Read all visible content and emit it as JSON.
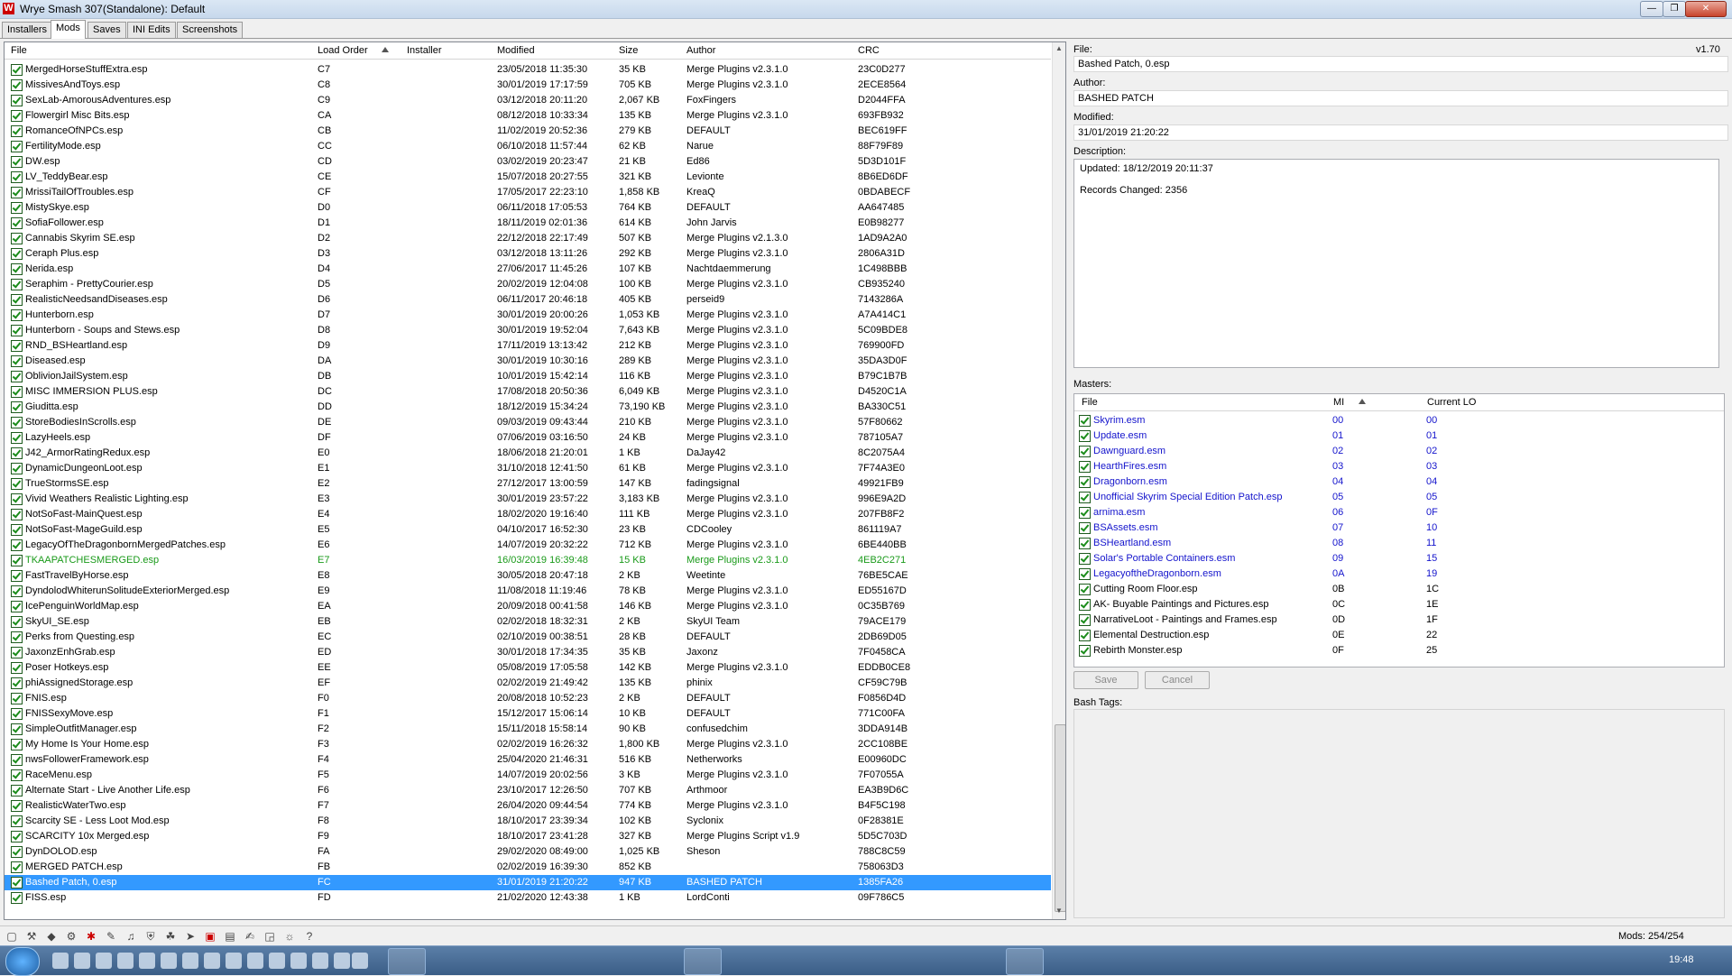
{
  "window": {
    "title": "Wrye Smash 307(Standalone): Default",
    "app_icon": "W"
  },
  "tabs": [
    "Installers",
    "Mods",
    "Saves",
    "INI Edits",
    "Screenshots"
  ],
  "mods_list": {
    "columns": {
      "file": "File",
      "load_order": "Load Order",
      "installer": "Installer",
      "modified": "Modified",
      "size": "Size",
      "author": "Author",
      "crc": "CRC"
    },
    "rows": [
      [
        "MergedHorseStuffExtra.esp",
        "C7",
        "23/05/2018 11:35:30",
        "35 KB",
        "Merge Plugins v2.3.1.0",
        "23C0D277"
      ],
      [
        "MissivesAndToys.esp",
        "C8",
        "30/01/2019 17:17:59",
        "705 KB",
        "Merge Plugins v2.3.1.0",
        "2ECE8564"
      ],
      [
        "SexLab-AmorousAdventures.esp",
        "C9",
        "03/12/2018 20:11:20",
        "2,067 KB",
        "FoxFingers",
        "D2044FFA"
      ],
      [
        "Flowergirl Misc Bits.esp",
        "CA",
        "08/12/2018 10:33:34",
        "135 KB",
        "Merge Plugins v2.3.1.0",
        "693FB932"
      ],
      [
        "RomanceOfNPCs.esp",
        "CB",
        "11/02/2019 20:52:36",
        "279 KB",
        "DEFAULT",
        "BEC619FF"
      ],
      [
        "FertilityMode.esp",
        "CC",
        "06/10/2018 11:57:44",
        "62 KB",
        "Narue",
        "88F79F89"
      ],
      [
        "DW.esp",
        "CD",
        "03/02/2019 20:23:47",
        "21 KB",
        "Ed86",
        "5D3D101F"
      ],
      [
        "LV_TeddyBear.esp",
        "CE",
        "15/07/2018 20:27:55",
        "321 KB",
        "Levionte",
        "8B6ED6DF"
      ],
      [
        "MrissiTailOfTroubles.esp",
        "CF",
        "17/05/2017 22:23:10",
        "1,858 KB",
        "KreaQ",
        "0BDABECF"
      ],
      [
        "MistySkye.esp",
        "D0",
        "06/11/2018 17:05:53",
        "764 KB",
        "DEFAULT",
        "AA647485"
      ],
      [
        "SofiaFollower.esp",
        "D1",
        "18/11/2019 02:01:36",
        "614 KB",
        "John Jarvis",
        "E0B98277"
      ],
      [
        "Cannabis Skyrim SE.esp",
        "D2",
        "22/12/2018 22:17:49",
        "507 KB",
        "Merge Plugins v2.1.3.0",
        "1AD9A2A0"
      ],
      [
        "Ceraph Plus.esp",
        "D3",
        "03/12/2018 13:11:26",
        "292 KB",
        "Merge Plugins v2.3.1.0",
        "2806A31D"
      ],
      [
        "Nerida.esp",
        "D4",
        "27/06/2017 11:45:26",
        "107 KB",
        "Nachtdaemmerung",
        "1C498BBB"
      ],
      [
        "Seraphim - PrettyCourier.esp",
        "D5",
        "20/02/2019 12:04:08",
        "100 KB",
        "Merge Plugins v2.3.1.0",
        "CB935240"
      ],
      [
        "RealisticNeedsandDiseases.esp",
        "D6",
        "06/11/2017 20:46:18",
        "405 KB",
        "perseid9",
        "7143286A"
      ],
      [
        "Hunterborn.esp",
        "D7",
        "30/01/2019 20:00:26",
        "1,053 KB",
        "Merge Plugins v2.3.1.0",
        "A7A414C1"
      ],
      [
        "Hunterborn - Soups and Stews.esp",
        "D8",
        "30/01/2019 19:52:04",
        "7,643 KB",
        "Merge Plugins v2.3.1.0",
        "5C09BDE8"
      ],
      [
        "RND_BSHeartland.esp",
        "D9",
        "17/11/2019 13:13:42",
        "212 KB",
        "Merge Plugins v2.3.1.0",
        "769900FD"
      ],
      [
        "Diseased.esp",
        "DA",
        "30/01/2019 10:30:16",
        "289 KB",
        "Merge Plugins v2.3.1.0",
        "35DA3D0F"
      ],
      [
        "OblivionJailSystem.esp",
        "DB",
        "10/01/2019 15:42:14",
        "116 KB",
        "Merge Plugins v2.3.1.0",
        "B79C1B7B"
      ],
      [
        "MISC IMMERSION PLUS.esp",
        "DC",
        "17/08/2018 20:50:36",
        "6,049 KB",
        "Merge Plugins v2.3.1.0",
        "D4520C1A"
      ],
      [
        "Giuditta.esp",
        "DD",
        "18/12/2019 15:34:24",
        "73,190 KB",
        "Merge Plugins v2.3.1.0",
        "BA330C51"
      ],
      [
        "StoreBodiesInScrolls.esp",
        "DE",
        "09/03/2019 09:43:44",
        "210 KB",
        "Merge Plugins v2.3.1.0",
        "57F80662"
      ],
      [
        "LazyHeels.esp",
        "DF",
        "07/06/2019 03:16:50",
        "24 KB",
        "Merge Plugins v2.3.1.0",
        "787105A7"
      ],
      [
        "J42_ArmorRatingRedux.esp",
        "E0",
        "18/06/2018 21:20:01",
        "1 KB",
        "DaJay42",
        "8C2075A4"
      ],
      [
        "DynamicDungeonLoot.esp",
        "E1",
        "31/10/2018 12:41:50",
        "61 KB",
        "Merge Plugins v2.3.1.0",
        "7F74A3E0"
      ],
      [
        "TrueStormsSE.esp",
        "E2",
        "27/12/2017 13:00:59",
        "147 KB",
        "fadingsignal",
        "49921FB9"
      ],
      [
        "Vivid Weathers Realistic Lighting.esp",
        "E3",
        "30/01/2019 23:57:22",
        "3,183 KB",
        "Merge Plugins v2.3.1.0",
        "996E9A2D"
      ],
      [
        "NotSoFast-MainQuest.esp",
        "E4",
        "18/02/2020 19:16:40",
        "111 KB",
        "Merge Plugins v2.3.1.0",
        "207FB8F2"
      ],
      [
        "NotSoFast-MageGuild.esp",
        "E5",
        "04/10/2017 16:52:30",
        "23 KB",
        "CDCooley",
        "861119A7"
      ],
      [
        "LegacyOfTheDragonbornMergedPatches.esp",
        "E6",
        "14/07/2019 20:32:22",
        "712 KB",
        "Merge Plugins v2.3.1.0",
        "6BE440BB"
      ],
      [
        "TKAAPATCHESMERGED.esp",
        "E7",
        "16/03/2019 16:39:48",
        "15 KB",
        "Merge Plugins v2.3.1.0",
        "4EB2C271"
      ],
      [
        "FastTravelByHorse.esp",
        "E8",
        "30/05/2018 20:47:18",
        "2 KB",
        "Weetinte",
        "76BE5CAE"
      ],
      [
        "DyndolodWhiterunSolitudeExteriorMerged.esp",
        "E9",
        "11/08/2018 11:19:46",
        "78 KB",
        "Merge Plugins v2.3.1.0",
        "ED55167D"
      ],
      [
        "IcePenguinWorldMap.esp",
        "EA",
        "20/09/2018 00:41:58",
        "146 KB",
        "Merge Plugins v2.3.1.0",
        "0C35B769"
      ],
      [
        "SkyUI_SE.esp",
        "EB",
        "02/02/2018 18:32:31",
        "2 KB",
        "SkyUI Team",
        "79ACE179"
      ],
      [
        "Perks from Questing.esp",
        "EC",
        "02/10/2019 00:38:51",
        "28 KB",
        "DEFAULT",
        "2DB69D05"
      ],
      [
        "JaxonzEnhGrab.esp",
        "ED",
        "30/01/2018 17:34:35",
        "35 KB",
        "Jaxonz",
        "7F0458CA"
      ],
      [
        "Poser Hotkeys.esp",
        "EE",
        "05/08/2019 17:05:58",
        "142 KB",
        "Merge Plugins v2.3.1.0",
        "EDDB0CE8"
      ],
      [
        "phiAssignedStorage.esp",
        "EF",
        "02/02/2019 21:49:42",
        "135 KB",
        "phinix",
        "CF59C79B"
      ],
      [
        "FNIS.esp",
        "F0",
        "20/08/2018 10:52:23",
        "2 KB",
        "DEFAULT",
        "F0856D4D"
      ],
      [
        "FNISSexyMove.esp",
        "F1",
        "15/12/2017 15:06:14",
        "10 KB",
        "DEFAULT",
        "771C00FA"
      ],
      [
        "SimpleOutfitManager.esp",
        "F2",
        "15/11/2018 15:58:14",
        "90 KB",
        "confusedchim",
        "3DDA914B"
      ],
      [
        "My Home Is Your Home.esp",
        "F3",
        "02/02/2019 16:26:32",
        "1,800 KB",
        "Merge Plugins v2.3.1.0",
        "2CC108BE"
      ],
      [
        "nwsFollowerFramework.esp",
        "F4",
        "25/04/2020 21:46:31",
        "516 KB",
        "Netherworks",
        "E00960DC"
      ],
      [
        "RaceMenu.esp",
        "F5",
        "14/07/2019 20:02:56",
        "3 KB",
        "Merge Plugins v2.3.1.0",
        "7F07055A"
      ],
      [
        "Alternate Start - Live Another Life.esp",
        "F6",
        "23/10/2017 12:26:50",
        "707 KB",
        "Arthmoor",
        "EA3B9D6C"
      ],
      [
        "RealisticWaterTwo.esp",
        "F7",
        "26/04/2020 09:44:54",
        "774 KB",
        "Merge Plugins v2.3.1.0",
        "B4F5C198"
      ],
      [
        "Scarcity SE - Less Loot Mod.esp",
        "F8",
        "18/10/2017 23:39:34",
        "102 KB",
        "Syclonix",
        "0F28381E"
      ],
      [
        "SCARCITY 10x Merged.esp",
        "F9",
        "18/10/2017 23:41:28",
        "327 KB",
        "Merge Plugins Script v1.9",
        "5D5C703D"
      ],
      [
        "DynDOLOD.esp",
        "FA",
        "29/02/2020 08:49:00",
        "1,025 KB",
        "Sheson",
        "788C8C59"
      ],
      [
        "MERGED PATCH.esp",
        "FB",
        "02/02/2019 16:39:30",
        "852 KB",
        "",
        "758063D3"
      ],
      [
        "Bashed Patch, 0.esp",
        "FC",
        "31/01/2019 21:20:22",
        "947 KB",
        "BASHED PATCH",
        "1385FA26"
      ],
      [
        "FISS.esp",
        "FD",
        "21/02/2020 12:43:38",
        "1 KB",
        "LordConti",
        "09F786C5"
      ]
    ]
  },
  "details": {
    "file_label": "File:",
    "file_value": "Bashed Patch, 0.esp",
    "version": "v1.70",
    "author_label": "Author:",
    "author_value": "BASHED PATCH",
    "modified_label": "Modified:",
    "modified_value": "31/01/2019 21:20:22",
    "description_label": "Description:",
    "description_line1": "Updated: 18/12/2019 20:11:37",
    "description_line2": "Records Changed: 2356",
    "masters_label": "Masters:",
    "masters_columns": {
      "file": "File",
      "mi": "MI",
      "current_lo": "Current LO"
    },
    "masters": [
      [
        "Skyrim.esm",
        "00",
        "00"
      ],
      [
        "Update.esm",
        "01",
        "01"
      ],
      [
        "Dawnguard.esm",
        "02",
        "02"
      ],
      [
        "HearthFires.esm",
        "03",
        "03"
      ],
      [
        "Dragonborn.esm",
        "04",
        "04"
      ],
      [
        "Unofficial Skyrim Special Edition Patch.esp",
        "05",
        "05"
      ],
      [
        "arnima.esm",
        "06",
        "0F"
      ],
      [
        "BSAssets.esm",
        "07",
        "10"
      ],
      [
        "BSHeartland.esm",
        "08",
        "11"
      ],
      [
        "Solar's Portable Containers.esm",
        "09",
        "15"
      ],
      [
        "LegacyoftheDragonborn.esm",
        "0A",
        "19"
      ],
      [
        "Cutting Room Floor.esp",
        "0B",
        "1C"
      ],
      [
        "AK- Buyable Paintings and Pictures.esp",
        "0C",
        "1E"
      ],
      [
        "NarrativeLoot - Paintings and Frames.esp",
        "0D",
        "1F"
      ],
      [
        "Elemental Destruction.esp",
        "0E",
        "22"
      ],
      [
        "Rebirth Monster.esp",
        "0F",
        "25"
      ]
    ],
    "save_label": "Save",
    "cancel_label": "Cancel",
    "bash_tags_label": "Bash Tags:"
  },
  "status": {
    "mods_count": "Mods: 254/254"
  },
  "taskbar": {
    "clock": "19:48"
  },
  "colors": {
    "selection": "#3399ff",
    "green_row": "#1a9a1a",
    "master_blue": "#1414cc"
  }
}
